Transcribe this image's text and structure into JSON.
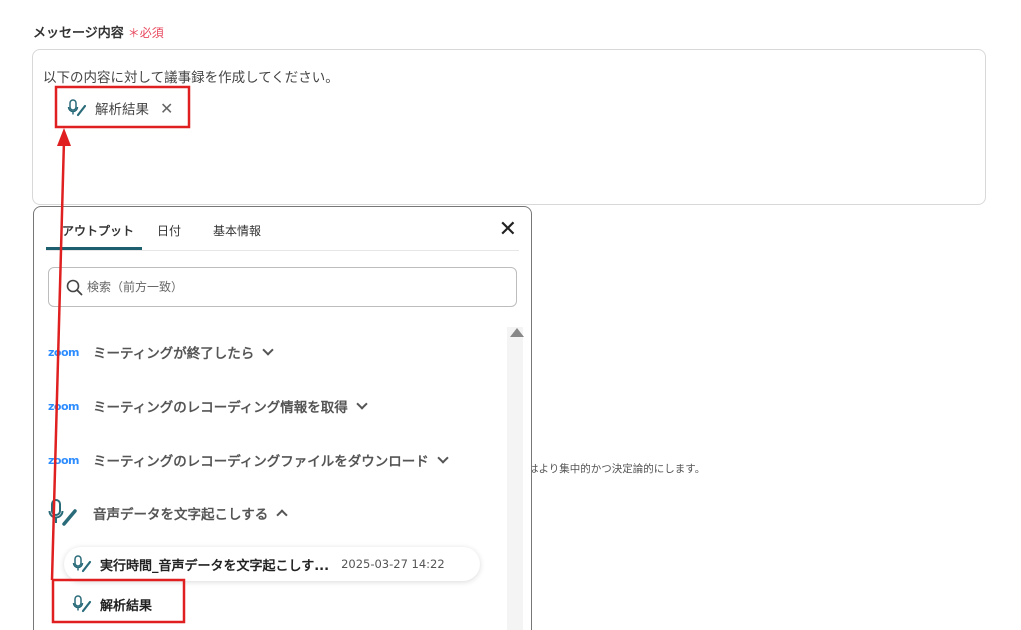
{
  "field": {
    "label": "メッセージ内容",
    "required_mark": "＊",
    "required_text": "必須"
  },
  "message": {
    "text": "以下の内容に対して議事録を作成してください。",
    "chip_label": "解析結果",
    "chip_remove": "✕"
  },
  "hint": "はより集中的かつ決定論的にします。",
  "panel": {
    "tabs": [
      {
        "label": "アウトプット",
        "active": true
      },
      {
        "label": "日付"
      },
      {
        "label": "基本情報"
      }
    ],
    "close": "✕",
    "search_placeholder": "検索（前方一致）",
    "zoom_logo": "zoom",
    "items": [
      {
        "label": "ミーティングが終了したら",
        "icon": "zoom-logo",
        "expanded": false
      },
      {
        "label": "ミーティングのレコーディング情報を取得",
        "icon": "zoom-logo",
        "expanded": false
      },
      {
        "label": "ミーティングのレコーディングファイルをダウンロード",
        "icon": "zoom-logo",
        "expanded": false
      },
      {
        "label": "音声データを文字起こしする",
        "icon": "mic-icon",
        "expanded": true
      }
    ],
    "sub_items": [
      {
        "label": "実行時間_音声データを文字起こしす...",
        "timestamp": "2025-03-27 14:22"
      },
      {
        "label": "解析結果"
      }
    ]
  },
  "colors": {
    "accent": "#1d5f6f",
    "zoom": "#2d8cff",
    "highlight": "#e02020",
    "required": "#e84a5f"
  }
}
